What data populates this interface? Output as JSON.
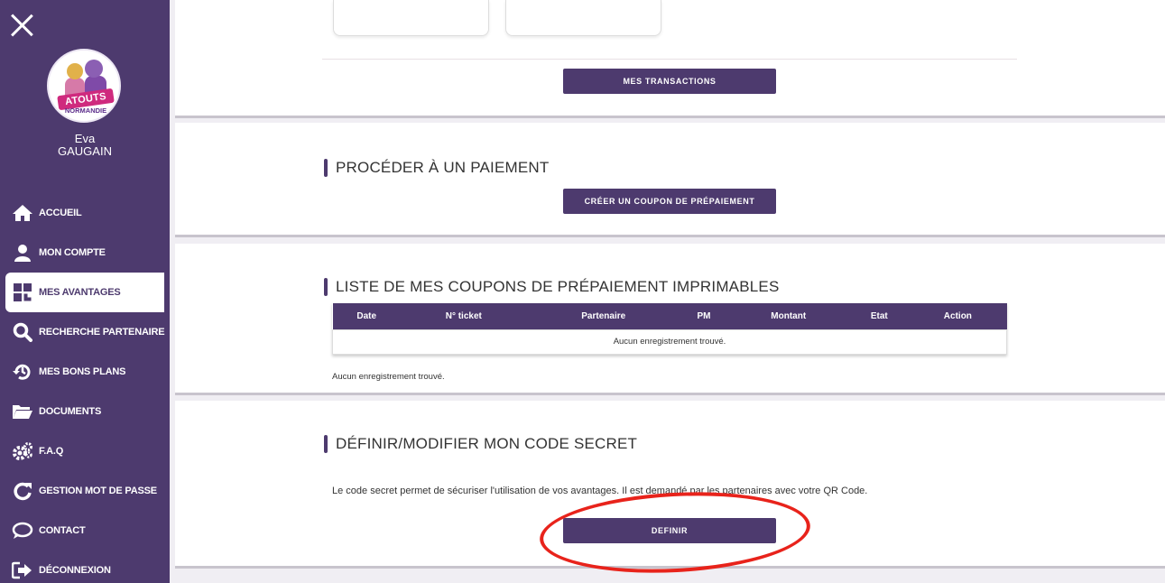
{
  "sidebar": {
    "logo_text": "ATOUTS",
    "logo_subtext": "NORMANDIE",
    "user_first_name": "Eva",
    "user_last_name": "GAUGAIN",
    "items": [
      {
        "label": "ACCUEIL",
        "icon": "home-icon"
      },
      {
        "label": "MON COMPTE",
        "icon": "user-icon"
      },
      {
        "label": "MES AVANTAGES",
        "icon": "qr-code-icon",
        "active": true
      },
      {
        "label": "RECHERCHE PARTENAIRE",
        "icon": "search-icon"
      },
      {
        "label": "MES BONS PLANS",
        "icon": "history-icon"
      },
      {
        "label": "DOCUMENTS",
        "icon": "folder-icon"
      },
      {
        "label": "F.A.Q",
        "icon": "gears-icon"
      },
      {
        "label": "GESTION MOT DE PASSE",
        "icon": "refresh-icon"
      },
      {
        "label": "CONTACT",
        "icon": "chat-icon"
      },
      {
        "label": "DÉCONNEXION",
        "icon": "logout-icon"
      }
    ]
  },
  "transactions": {
    "button_label": "MES TRANSACTIONS"
  },
  "payment": {
    "title": "PROCÉDER À UN PAIEMENT",
    "button_label": "CRÉER UN COUPON DE PRÉPAIEMENT"
  },
  "coupons": {
    "title": "LISTE DE MES COUPONS DE PRÉPAIEMENT IMPRIMABLES",
    "columns": [
      "Date",
      "N° ticket",
      "Partenaire",
      "PM",
      "Montant",
      "Etat",
      "Action"
    ],
    "empty_row": "Aucun enregistrement trouvé.",
    "empty_note": "Aucun enregistrement trouvé."
  },
  "secret_code": {
    "title": "DÉFINIR/MODIFIER MON CODE SECRET",
    "description": "Le code secret permet de sécuriser l'utilisation de vos avantages. Il est demandé par les partenaires avec votre QR Code.",
    "button_label": "DEFINIR"
  },
  "colors": {
    "primary": "#4d3a6e",
    "annotation": "#e8231b"
  }
}
